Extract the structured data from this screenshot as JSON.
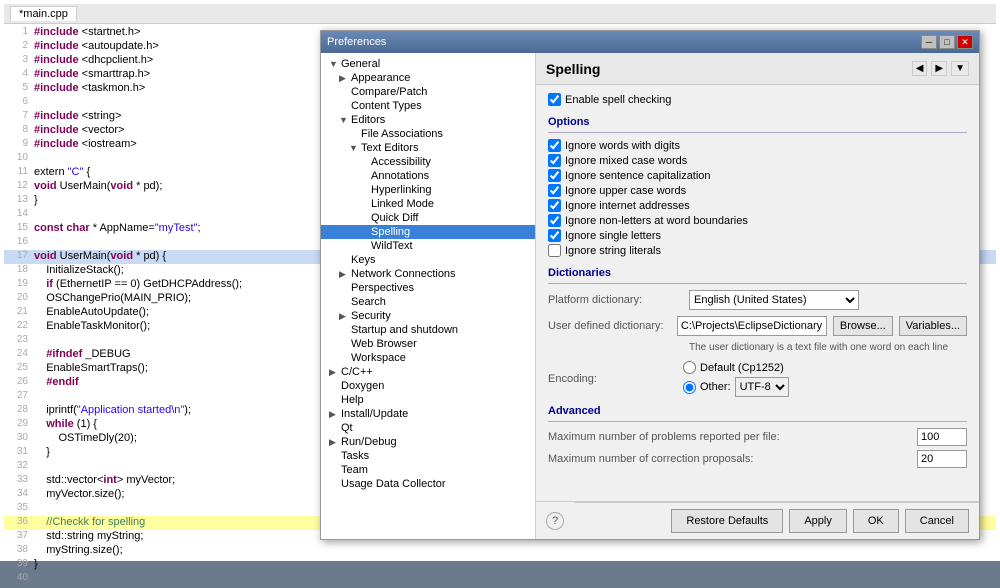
{
  "editor": {
    "tab_label": "*main.cpp",
    "lines": [
      {
        "num": 1,
        "content": "#include <startnet.h>",
        "type": "include"
      },
      {
        "num": 2,
        "content": "#include <autoupdate.h>",
        "type": "include"
      },
      {
        "num": 3,
        "content": "#include <dhcpclient.h>",
        "type": "include"
      },
      {
        "num": 4,
        "content": "#include <smarttrap.h>",
        "type": "include"
      },
      {
        "num": 5,
        "content": "#include <taskmon.h>",
        "type": "include"
      },
      {
        "num": 6,
        "content": ""
      },
      {
        "num": 7,
        "content": "#include <string>",
        "type": "include"
      },
      {
        "num": 8,
        "content": "#include <vector>",
        "type": "include"
      },
      {
        "num": 9,
        "content": "#include <iostream>",
        "type": "include"
      },
      {
        "num": 10,
        "content": ""
      },
      {
        "num": 11,
        "content": "extern \"C\" {"
      },
      {
        "num": 12,
        "content": "void UserMain(void * pd);"
      },
      {
        "num": 13,
        "content": "}"
      },
      {
        "num": 14,
        "content": ""
      },
      {
        "num": 15,
        "content": "const char * AppName=\"myTest\";"
      },
      {
        "num": 16,
        "content": ""
      },
      {
        "num": 17,
        "content": "void UserMain(void * pd) {"
      },
      {
        "num": 18,
        "content": "    InitializeStack();"
      },
      {
        "num": 19,
        "content": "    if (EthernetIP == 0) GetDHCPAddress();"
      },
      {
        "num": 20,
        "content": "    OSChangePrio(MAIN_PRIO);"
      },
      {
        "num": 21,
        "content": "    EnableAutoUpdate();"
      },
      {
        "num": 22,
        "content": "    EnableTaskMonitor();"
      },
      {
        "num": 23,
        "content": ""
      },
      {
        "num": 24,
        "content": "    #ifndef _DEBUG"
      },
      {
        "num": 25,
        "content": "    EnableSmartTraps();"
      },
      {
        "num": 26,
        "content": "    #endif"
      },
      {
        "num": 27,
        "content": ""
      },
      {
        "num": 28,
        "content": "    iprintf(\"Application started\\n\");"
      },
      {
        "num": 29,
        "content": "    while (1) {"
      },
      {
        "num": 30,
        "content": "        OSTimeDly(20);"
      },
      {
        "num": 31,
        "content": "    }"
      },
      {
        "num": 32,
        "content": ""
      },
      {
        "num": 33,
        "content": "    std::vector<int> myVector;"
      },
      {
        "num": 34,
        "content": "    myVector.size();"
      },
      {
        "num": 35,
        "content": ""
      },
      {
        "num": 36,
        "content": "    //Checkk for spelling",
        "type": "comment",
        "highlight": true
      },
      {
        "num": 37,
        "content": "    std::string myString;"
      },
      {
        "num": 38,
        "content": "    myString.size();"
      },
      {
        "num": 39,
        "content": "}"
      }
    ]
  },
  "dialog": {
    "title": "Preferences",
    "tree": {
      "items": [
        {
          "id": "general",
          "label": "General",
          "level": 1,
          "expanded": true
        },
        {
          "id": "appearance",
          "label": "Appearance",
          "level": 2,
          "expanded": false
        },
        {
          "id": "compare_patch",
          "label": "Compare/Patch",
          "level": 2
        },
        {
          "id": "content_types",
          "label": "Content Types",
          "level": 2
        },
        {
          "id": "editors",
          "label": "Editors",
          "level": 2,
          "expanded": true
        },
        {
          "id": "file_assoc",
          "label": "File Associations",
          "level": 3
        },
        {
          "id": "text_editors",
          "label": "Text Editors",
          "level": 3,
          "expanded": true
        },
        {
          "id": "accessibility",
          "label": "Accessibility",
          "level": 4
        },
        {
          "id": "annotations",
          "label": "Annotations",
          "level": 4
        },
        {
          "id": "hyperlinking",
          "label": "Hyperlinking",
          "level": 4
        },
        {
          "id": "linked_mode",
          "label": "Linked Mode",
          "level": 4
        },
        {
          "id": "quick_diff",
          "label": "Quick Diff",
          "level": 4
        },
        {
          "id": "spelling",
          "label": "Spelling",
          "level": 4,
          "selected": true
        },
        {
          "id": "wildtext",
          "label": "WildText",
          "level": 4
        },
        {
          "id": "keys",
          "label": "Keys",
          "level": 2
        },
        {
          "id": "network_conn",
          "label": "Network Connections",
          "level": 2,
          "expanded": false
        },
        {
          "id": "perspectives",
          "label": "Perspectives",
          "level": 2
        },
        {
          "id": "search",
          "label": "Search",
          "level": 2
        },
        {
          "id": "security",
          "label": "Security",
          "level": 2,
          "expanded": false
        },
        {
          "id": "startup_shutdown",
          "label": "Startup and shutdown",
          "level": 2
        },
        {
          "id": "web_browser",
          "label": "Web Browser",
          "level": 2
        },
        {
          "id": "workspace",
          "label": "Workspace",
          "level": 2
        },
        {
          "id": "cpp",
          "label": "C/C++",
          "level": 1,
          "expanded": false
        },
        {
          "id": "doxygen",
          "label": "Doxygen",
          "level": 1
        },
        {
          "id": "help",
          "label": "Help",
          "level": 1
        },
        {
          "id": "install_update",
          "label": "Install/Update",
          "level": 1,
          "expanded": false
        },
        {
          "id": "qt",
          "label": "Qt",
          "level": 1
        },
        {
          "id": "run_debug",
          "label": "Run/Debug",
          "level": 1,
          "expanded": false
        },
        {
          "id": "tasks",
          "label": "Tasks",
          "level": 1
        },
        {
          "id": "team",
          "label": "Team",
          "level": 1
        },
        {
          "id": "usage_data",
          "label": "Usage Data Collector",
          "level": 1
        }
      ]
    },
    "spelling": {
      "page_title": "Spelling",
      "enable_label": "Enable spell checking",
      "options_label": "Options",
      "options": [
        {
          "id": "digits",
          "label": "Ignore words with digits",
          "checked": true
        },
        {
          "id": "mixed_case",
          "label": "Ignore mixed case words",
          "checked": true
        },
        {
          "id": "sentence_cap",
          "label": "Ignore sentence capitalization",
          "checked": true
        },
        {
          "id": "upper_case",
          "label": "Ignore upper case words",
          "checked": true
        },
        {
          "id": "internet",
          "label": "Ignore internet addresses",
          "checked": true
        },
        {
          "id": "word_boundaries",
          "label": "Ignore non-letters at word boundaries",
          "checked": true
        },
        {
          "id": "single_letters",
          "label": "Ignore single letters",
          "checked": true
        },
        {
          "id": "string_literals",
          "label": "Ignore string literals",
          "checked": false
        }
      ],
      "dictionaries_label": "Dictionaries",
      "platform_dict_label": "Platform dictionary:",
      "platform_dict_value": "English (United States)",
      "user_dict_label": "User defined dictionary:",
      "user_dict_value": "C:\\Projects\\EclipseDictionary",
      "browse_label": "Browse...",
      "variables_label": "Variables...",
      "dict_note": "The user dictionary is a text file with one word on each line",
      "encoding_label": "Encoding:",
      "encoding_default": "Default (Cp1252)",
      "encoding_other": "Other:",
      "encoding_other_value": "UTF-8",
      "advanced_label": "Advanced",
      "max_problems_label": "Maximum number of problems reported per file:",
      "max_problems_value": "100",
      "max_proposals_label": "Maximum number of correction proposals:",
      "max_proposals_value": "20"
    },
    "footer": {
      "restore_label": "Restore Defaults",
      "apply_label": "Apply",
      "ok_label": "OK",
      "cancel_label": "Cancel"
    },
    "help_icon": "?"
  }
}
